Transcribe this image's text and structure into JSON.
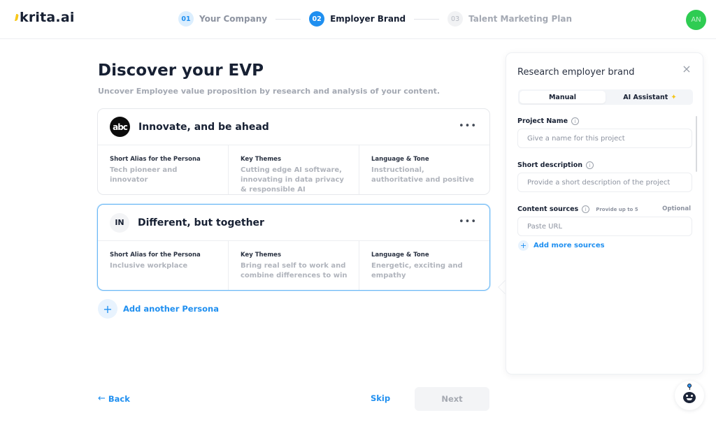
{
  "header": {
    "logo_text": "krita.ai",
    "steps": [
      {
        "num": "01",
        "label": "Your Company",
        "state": "done"
      },
      {
        "num": "02",
        "label": "Employer Brand",
        "state": "active"
      },
      {
        "num": "03",
        "label": "Talent Marketing Plan",
        "state": "todo"
      }
    ],
    "user_initials": "AN",
    "user_color": "#2ecc52"
  },
  "main": {
    "title": "Discover your EVP",
    "subtitle": "Uncover Employee value proposition by research and analysis of your content.",
    "personas": [
      {
        "logo_text": "abc",
        "title": "Innovate, and be ahead",
        "more_icon": "ellipsis-icon",
        "selected": false,
        "columns": [
          {
            "label": "Short Alias for the Persona",
            "value": "Tech pioneer and innovator"
          },
          {
            "label": "Key Themes",
            "value": "Cutting edge AI software, innovating in data privacy & responsible AI"
          },
          {
            "label": "Language & Tone",
            "value": "Instructional, authoritative and positive"
          }
        ]
      },
      {
        "logo_text": "IN",
        "title": "Different, but together",
        "more_icon": "ellipsis-icon",
        "selected": true,
        "columns": [
          {
            "label": "Short Alias for the Persona",
            "value": "Inclusive workplace"
          },
          {
            "label": "Key Themes",
            "value": "Bring real self to work and combine differences to win"
          },
          {
            "label": "Language & Tone",
            "value": "Energetic, exciting and empathy"
          }
        ]
      }
    ],
    "add_persona_label": "Add another Persona",
    "add_icon": "+"
  },
  "footer": {
    "back_label": "Back",
    "back_arrow": "←",
    "skip_label": "Skip",
    "next_label": "Next"
  },
  "panel": {
    "title": "Research employer brand",
    "close_icon": "×",
    "tabs": [
      {
        "label": "Manual",
        "active": true
      },
      {
        "label": "AI Assistant",
        "active": false,
        "icon": "✦"
      }
    ],
    "fields": {
      "project_name": {
        "label": "Project Name",
        "placeholder": "Give a name for this project",
        "value": ""
      },
      "short_description": {
        "label": "Short description",
        "placeholder": "Provide a short description of the project",
        "value": ""
      },
      "content_sources": {
        "label": "Content sources",
        "hint": "Provide up to 5",
        "optional_label": "Optional",
        "placeholder": "Paste URL",
        "value": ""
      }
    },
    "info_icon": "i",
    "add_sources_label": "Add more sources"
  },
  "colors": {
    "accent": "#1f8ff0",
    "text_primary": "#172033",
    "text_muted": "#a3a8b2",
    "logo_yellow": "#f8c81c"
  }
}
